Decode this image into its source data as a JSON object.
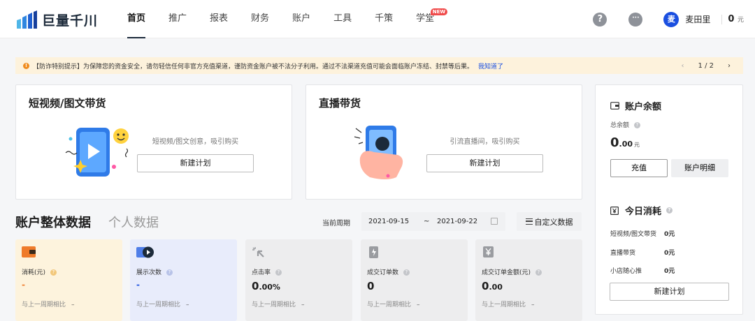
{
  "header": {
    "logo_text": "巨量千川",
    "nav": [
      {
        "label": "首页",
        "active": true
      },
      {
        "label": "推广"
      },
      {
        "label": "报表"
      },
      {
        "label": "财务"
      },
      {
        "label": "账户"
      },
      {
        "label": "工具"
      },
      {
        "label": "千策"
      },
      {
        "label": "学堂",
        "badge": "NEW"
      }
    ],
    "help_glyph": "?",
    "message_glyph": "···",
    "user_avatar_text": "麦",
    "user_name": "麦田里",
    "balance_value": "0",
    "balance_unit": "元"
  },
  "notice": {
    "icon_glyph": "!",
    "text": "【防诈特别提示】为保障您的资金安全，请勿轻信任何非官方充值渠道，谨防资金账户被不法分子利用。通过不法渠道充值可能会面临账户冻结、封禁等后果。",
    "link": "我知道了",
    "prev": "‹",
    "page": "1 / 2",
    "next": "›"
  },
  "cards": {
    "short_video": {
      "title": "短视频/图文带货",
      "desc": "短视频/图文创意，吸引购买",
      "button": "新建计划"
    },
    "live": {
      "title": "直播带货",
      "desc": "引流直播间，吸引购买",
      "button": "新建计划"
    }
  },
  "account_panel": {
    "balance_title": "账户余额",
    "total_balance_label": "总余额",
    "total_balance_int": "0",
    "total_balance_dec": ".00",
    "total_balance_unit": "元",
    "recharge_button": "充值",
    "detail_button": "账户明细",
    "today_title": "今日消耗",
    "today_rows": [
      {
        "label": "短视频/图文带货",
        "value": "0元"
      },
      {
        "label": "直播带货",
        "value": "0元"
      },
      {
        "label": "小店随心推",
        "value": "0元"
      }
    ],
    "new_plan_button": "新建计划"
  },
  "data_section": {
    "title": "账户整体数据",
    "title_alt": "个人数据",
    "period_label": "当前周期",
    "date_start": "2021-09-15",
    "date_sep": "~",
    "date_end": "2021-09-22",
    "custom_button": "自定义数据",
    "metrics": [
      {
        "label": "消耗(元)",
        "value": "-",
        "compare": "与上一周期相比",
        "compare_value": "–"
      },
      {
        "label": "展示次数",
        "value": "-",
        "compare": "与上一周期相比",
        "compare_value": "–"
      },
      {
        "label": "点击率",
        "value_int": "0",
        "value_dec": ".00%",
        "compare": "与上一周期相比",
        "compare_value": "–"
      },
      {
        "label": "成交订单数",
        "value": "0",
        "compare": "与上一周期相比",
        "compare_value": "–"
      },
      {
        "label": "成交订单金额(元)",
        "value_int": "0",
        "value_dec": ".00",
        "compare": "与上一周期相比",
        "compare_value": "–"
      }
    ]
  },
  "colors": {
    "accent_blue": "#1a4fe0",
    "brand_dark": "#1c2a3a",
    "notice_bg": "#fdf2dc",
    "warning_orange": "#f08c1e",
    "badge_red": "#f04b4b",
    "metric_yellow": "#fdf3dd",
    "metric_blue": "#e8ecfb",
    "metric_gray": "#ededee"
  }
}
